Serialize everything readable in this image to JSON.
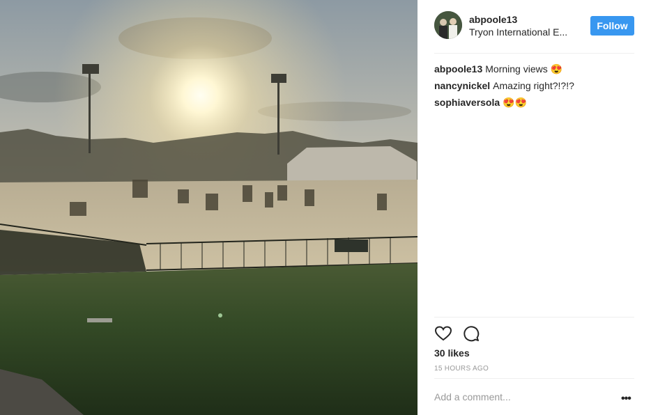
{
  "post": {
    "username": "abpoole13",
    "location": "Tryon International E...",
    "follow_label": "Follow",
    "likes": "30 likes",
    "timestamp": "15 HOURS AGO",
    "comment_placeholder": "Add a comment...",
    "more_label": "•••"
  },
  "comments": [
    {
      "author": "abpoole13",
      "text": "Morning views 😍"
    },
    {
      "author": "nancynickel",
      "text": "Amazing right?!?!?"
    },
    {
      "author": "sophiaversola",
      "text": "😍😍"
    }
  ],
  "icons": {
    "like": "heart-icon",
    "comment": "comment-icon"
  },
  "colors": {
    "follow_button": "#3897f0",
    "text": "#262626",
    "muted": "#999999",
    "divider": "#efefef"
  }
}
